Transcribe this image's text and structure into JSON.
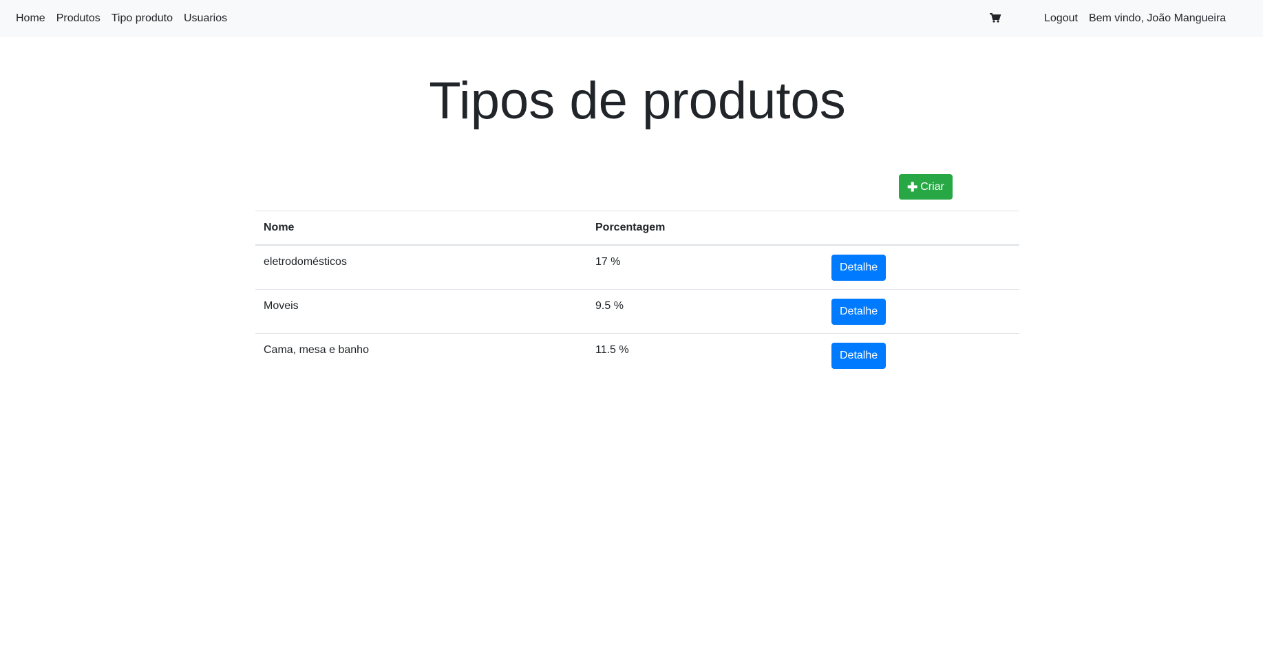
{
  "navbar": {
    "links": [
      "Home",
      "Produtos",
      "Tipo produto",
      "Usuarios"
    ],
    "cart_icon": "cart-icon",
    "logout": "Logout",
    "welcome": "Bem vindo, João Mangueira"
  },
  "page": {
    "title": "Tipos de produtos",
    "create_button": "Criar",
    "create_icon": "plus-icon"
  },
  "table": {
    "headers": [
      "Nome",
      "Porcentagem",
      ""
    ],
    "rows": [
      {
        "nome": "eletrodomésticos",
        "porcentagem": "17 %",
        "action": "Detalhe"
      },
      {
        "nome": "Moveis",
        "porcentagem": "9.5 %",
        "action": "Detalhe"
      },
      {
        "nome": "Cama, mesa e banho",
        "porcentagem": "11.5 %",
        "action": "Detalhe"
      }
    ]
  },
  "colors": {
    "navbar_bg": "#f8f9fa",
    "success": "#28a745",
    "primary": "#007bff",
    "text": "#212529"
  }
}
